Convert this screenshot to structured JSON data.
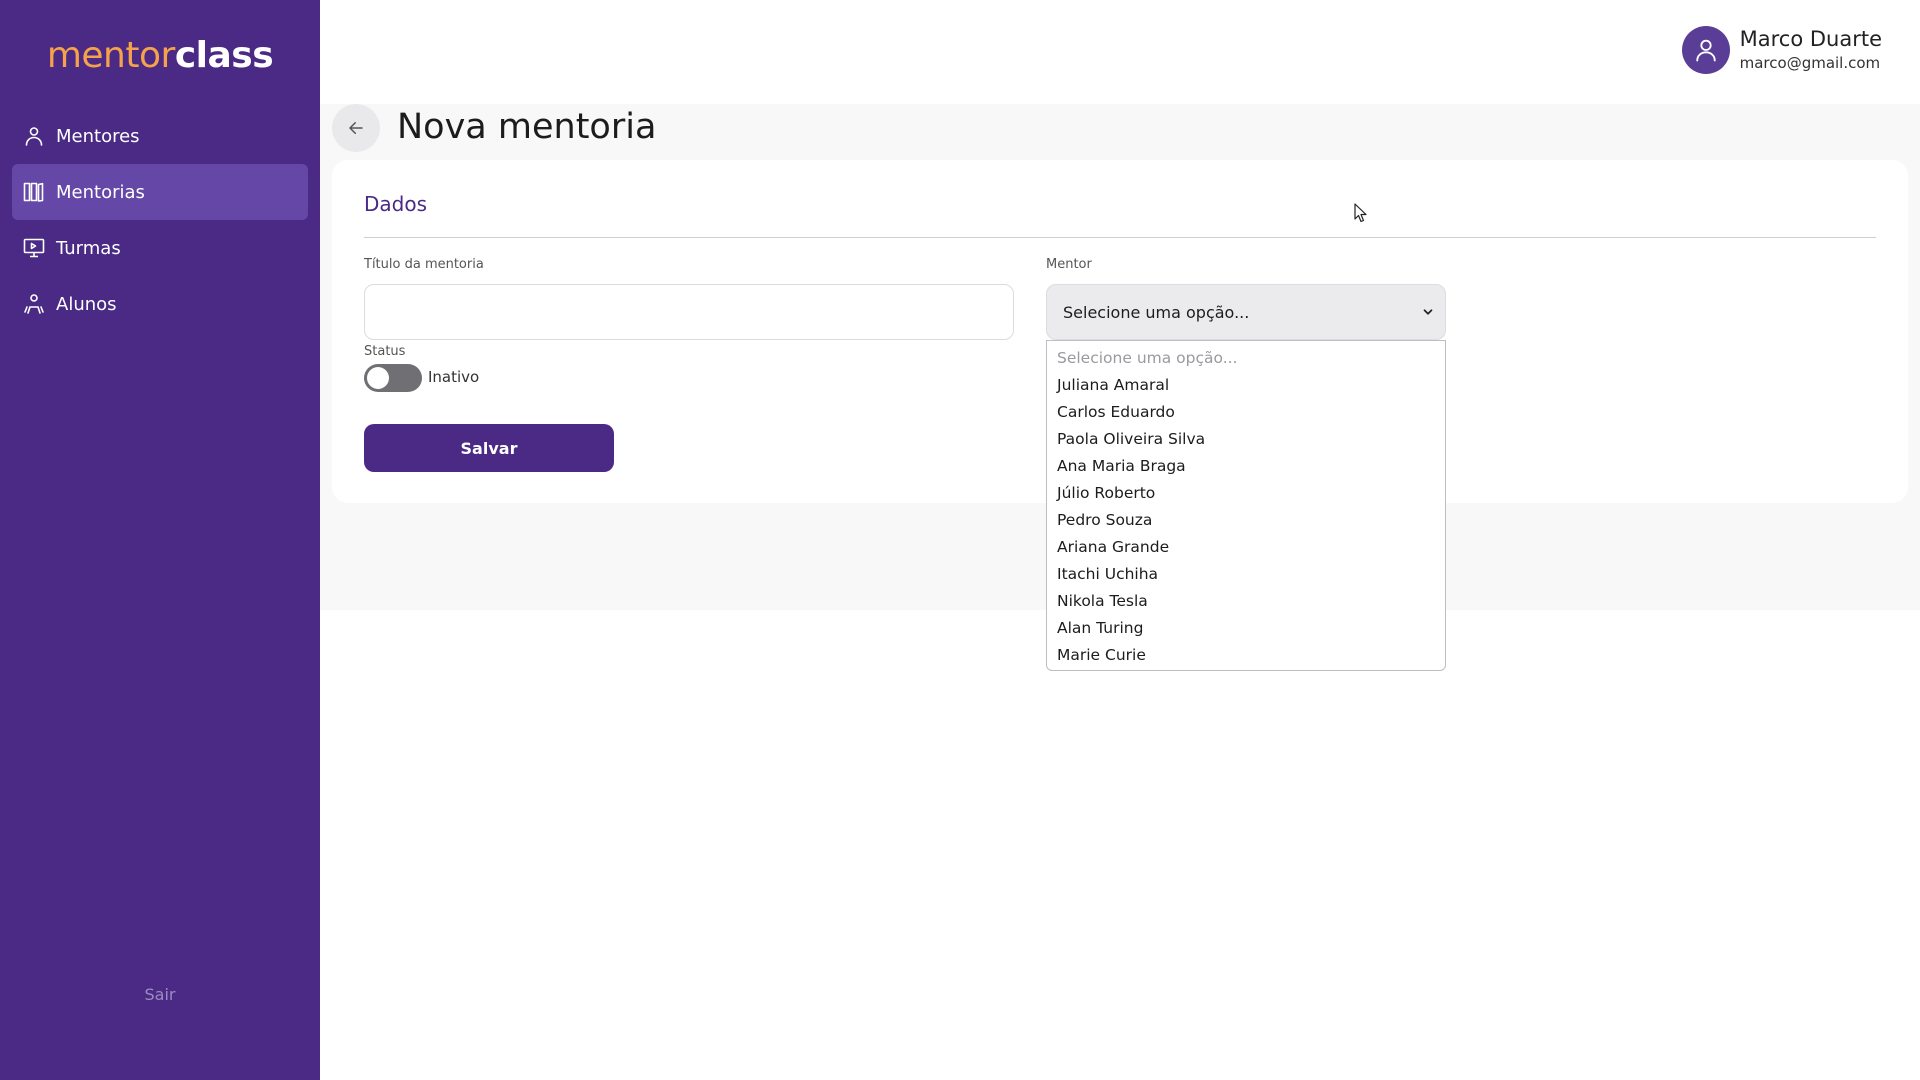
{
  "brand": {
    "part1": "mentor",
    "part2": "class",
    "accent": "#f5a24a",
    "sidebar_color": "#4a2a85"
  },
  "sidebar": {
    "items": [
      {
        "label": "Mentores",
        "icon": "person-icon",
        "active": false
      },
      {
        "label": "Mentorias",
        "icon": "library-icon",
        "active": true
      },
      {
        "label": "Turmas",
        "icon": "presentation-icon",
        "active": false
      },
      {
        "label": "Alunos",
        "icon": "group-icon",
        "active": false
      }
    ],
    "logout_label": "Sair"
  },
  "user": {
    "name": "Marco Duarte",
    "email": "marco@gmail.com",
    "icon": "user-icon"
  },
  "page": {
    "title": "Nova mentoria",
    "back_icon": "arrow-left-icon"
  },
  "form": {
    "section_title": "Dados",
    "title_label": "Título da mentoria",
    "title_value": "",
    "status_label": "Status",
    "status_value": "Inativo",
    "status_on": false,
    "save_label": "Salvar",
    "mentor_label": "Mentor",
    "mentor_selected": "Selecione uma opção...",
    "mentor_options": [
      "Selecione uma opção...",
      "Juliana Amaral",
      "Carlos Eduardo",
      "Paola Oliveira Silva",
      "Ana Maria Braga",
      "Júlio Roberto",
      "Pedro Souza",
      "Ariana Grande",
      "Itachi Uchiha",
      "Nikola Tesla",
      "Alan Turing",
      "Marie Curie"
    ]
  }
}
